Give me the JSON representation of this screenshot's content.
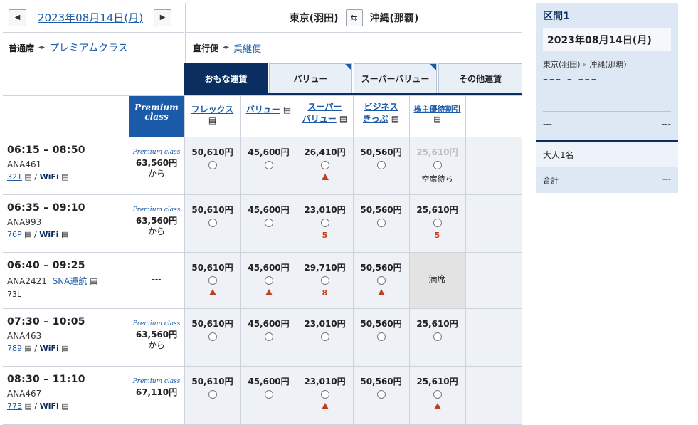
{
  "date_bar": {
    "date": "2023年08月14日(月)",
    "prev": "◀",
    "next": "▶"
  },
  "route": {
    "from": "東京(羽田)",
    "to": "沖縄(那覇)",
    "swap": "⇆"
  },
  "class_toggle": {
    "current": "普通席",
    "alt": "プレミアムクラス"
  },
  "flight_toggle": {
    "current": "直行便",
    "alt": "乗継便"
  },
  "tabs": [
    "おもな運賃",
    "バリュー",
    "スーパーバリュー",
    "その他運賃"
  ],
  "columns": {
    "premium": [
      "Premium",
      "class"
    ],
    "fares": [
      [
        "フレックス"
      ],
      [
        "バリュー"
      ],
      [
        "スーパー",
        "バリュー"
      ],
      [
        "ビジネス",
        "きっぷ"
      ],
      [
        "株主優待割引"
      ]
    ]
  },
  "flights": [
    {
      "time": "06:15 – 08:50",
      "no": "ANA461",
      "ac": "321",
      "wifi": "WiFi",
      "premium": [
        "Premium class",
        "63,560円",
        "から"
      ],
      "fares": [
        {
          "p": "50,610円",
          "m": ""
        },
        {
          "p": "45,600円",
          "m": ""
        },
        {
          "p": "26,410円",
          "m": "tri"
        },
        {
          "p": "50,560円",
          "m": ""
        },
        {
          "p": "25,610円",
          "m": "wait"
        }
      ]
    },
    {
      "time": "06:35 – 09:10",
      "no": "ANA993",
      "ac": "76P",
      "wifi": "WiFi",
      "premium": [
        "Premium class",
        "63,560円",
        "から"
      ],
      "fares": [
        {
          "p": "50,610円",
          "m": ""
        },
        {
          "p": "45,600円",
          "m": ""
        },
        {
          "p": "23,010円",
          "m": "5"
        },
        {
          "p": "50,560円",
          "m": ""
        },
        {
          "p": "25,610円",
          "m": "5"
        }
      ]
    },
    {
      "time": "06:40 – 09:25",
      "no": "ANA2421",
      "op": "SNA運航",
      "ac": "73L",
      "wifi": "",
      "premium": [
        "---"
      ],
      "fares": [
        {
          "p": "50,610円",
          "m": "tri"
        },
        {
          "p": "45,600円",
          "m": "tri"
        },
        {
          "p": "29,710円",
          "m": "8"
        },
        {
          "p": "50,560円",
          "m": "tri"
        },
        {
          "p": "満席",
          "m": "full"
        }
      ]
    },
    {
      "time": "07:30 – 10:05",
      "no": "ANA463",
      "ac": "789",
      "wifi": "WiFi",
      "premium": [
        "Premium class",
        "63,560円",
        "から"
      ],
      "fares": [
        {
          "p": "50,610円",
          "m": ""
        },
        {
          "p": "45,600円",
          "m": ""
        },
        {
          "p": "23,010円",
          "m": ""
        },
        {
          "p": "50,560円",
          "m": ""
        },
        {
          "p": "25,610円",
          "m": ""
        }
      ]
    },
    {
      "time": "08:30 – 11:10",
      "no": "ANA467",
      "ac": "773",
      "wifi": "WiFi",
      "premium": [
        "Premium class",
        "67,110円"
      ],
      "fares": [
        {
          "p": "50,610円",
          "m": ""
        },
        {
          "p": "45,600円",
          "m": ""
        },
        {
          "p": "23,010円",
          "m": "tri"
        },
        {
          "p": "50,560円",
          "m": ""
        },
        {
          "p": "25,610円",
          "m": "tri"
        }
      ]
    }
  ],
  "wait_label": "空席待ち",
  "sidebar": {
    "title": "区間1",
    "date": "2023年08月14日(月)",
    "from": "東京(羽田)",
    "to": "沖縄(那覇)",
    "time_dash": "––– – –––",
    "flight_dash": "---",
    "row_left": "---",
    "row_right": "---",
    "pax": "大人1名",
    "total_label": "合計",
    "total_value": "---"
  }
}
